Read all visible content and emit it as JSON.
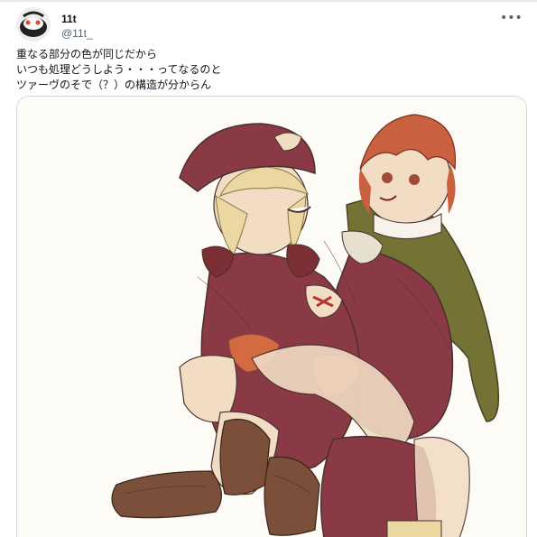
{
  "post": {
    "author_name": "11t",
    "author_handle": "@11t_",
    "more_icon": "more-horizontal-icon",
    "text_lines": [
      "重なる部分の色が同じだから",
      "いつも処理どうしよう・・・ってなるのと",
      "ツァーヴのそで（？）の構造が分からん"
    ]
  },
  "media": {
    "type": "illustration",
    "palette": {
      "paper": "#fdfbf6",
      "red_cloth": "#8a3a44",
      "green_cape": "#6d6b2a",
      "skin": "#f1dcc4",
      "blonde": "#ead7a2",
      "red_hair": "#c9603f",
      "orange_accent": "#d9713f",
      "boots": "#7b4f3a",
      "line": "#4a2f2f"
    }
  }
}
